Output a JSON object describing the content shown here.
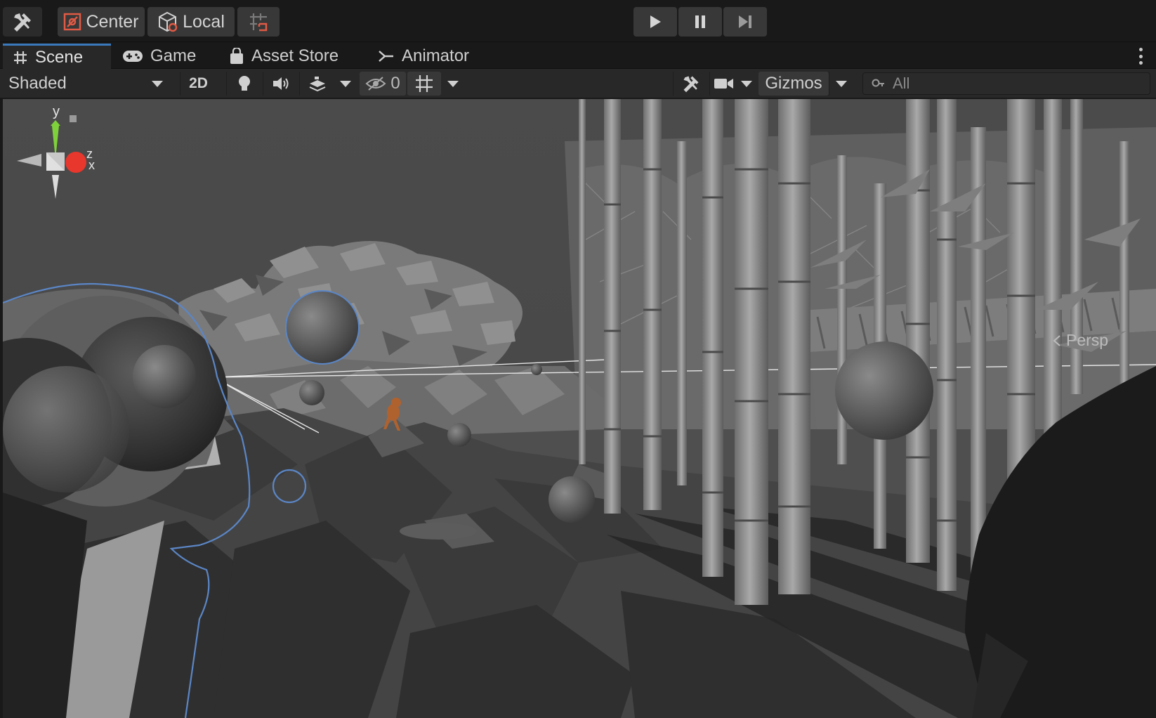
{
  "toolbar": {
    "pivot_label": "Center",
    "space_label": "Local"
  },
  "tabs": [
    {
      "label": "Scene",
      "active": true
    },
    {
      "label": "Game",
      "active": false
    },
    {
      "label": "Asset Store",
      "active": false
    },
    {
      "label": "Animator",
      "active": false
    }
  ],
  "scene_toolbar": {
    "draw_mode": "Shaded",
    "mode_2d": "2D",
    "hidden_count": "0",
    "gizmos_label": "Gizmos",
    "search_placeholder": "All"
  },
  "scene_gizmo": {
    "y_label": "y",
    "z_label": "z",
    "x_label": "x",
    "projection": "Persp"
  },
  "colors": {
    "accent_blue": "#3a79bb",
    "gizmo_y": "#7fd13b",
    "gizmo_x": "#e8372c",
    "selection_outline": "#5b86c6"
  }
}
